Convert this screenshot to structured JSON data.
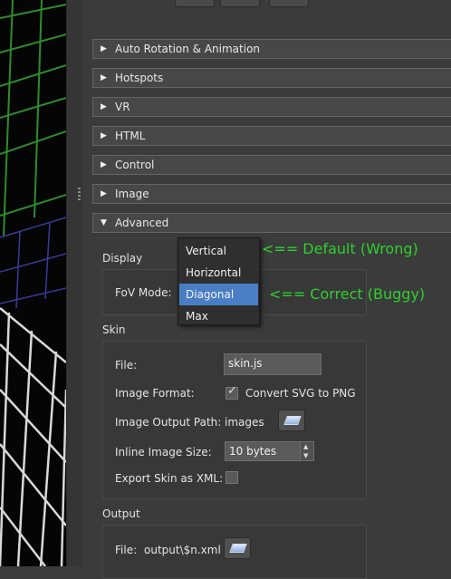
{
  "sections": [
    {
      "label": "Auto Rotation & Animation"
    },
    {
      "label": "Hotspots"
    },
    {
      "label": "VR"
    },
    {
      "label": "HTML"
    },
    {
      "label": "Control"
    },
    {
      "label": "Image"
    },
    {
      "label": "Advanced"
    }
  ],
  "display": {
    "group_label": "Display",
    "fov_label": "FoV Mode:",
    "fov_options": [
      "Vertical",
      "Horizontal",
      "Diagonal",
      "Max"
    ],
    "fov_selected": "Diagonal"
  },
  "annotations": {
    "default_note": "<== Default (Wrong)",
    "correct_note": "<== Correct (Buggy)"
  },
  "skin": {
    "group_label": "Skin",
    "file_label": "File:",
    "file_value": "skin.js",
    "image_format_label": "Image Format:",
    "convert_svg_label": "Convert SVG to PNG",
    "convert_svg_checked": true,
    "image_output_path_label": "Image Output Path:",
    "image_output_path_value": "images",
    "inline_image_size_label": "Inline Image Size:",
    "inline_image_size_value": "10 bytes",
    "export_xml_label": "Export Skin as XML:",
    "export_xml_checked": false
  },
  "output": {
    "group_label": "Output",
    "file_label": "File:",
    "file_value": "output\\$n.xml"
  },
  "colors": {
    "annotation": "#2fcf2f",
    "selection": "#4a7ec4",
    "grid_green": "#2e8c2e",
    "grid_blue": "#3a3a9a"
  }
}
